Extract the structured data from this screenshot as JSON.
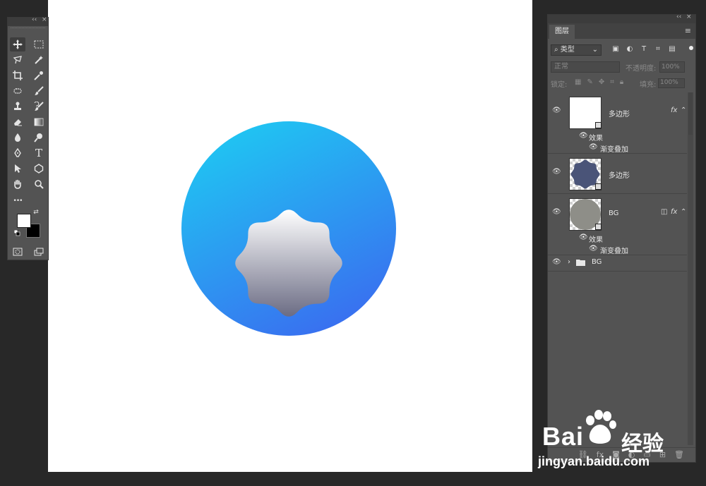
{
  "tools_panel": {
    "collapse_glyph": "‹‹",
    "close_glyph": "×",
    "tools": [
      {
        "icon": "move-tool-icon"
      },
      {
        "icon": "marquee-tool-icon"
      },
      {
        "icon": "lasso-tool-icon"
      },
      {
        "icon": "magic-wand-tool-icon"
      },
      {
        "icon": "crop-tool-icon"
      },
      {
        "icon": "eyedropper-tool-icon"
      },
      {
        "icon": "healing-brush-tool-icon"
      },
      {
        "icon": "brush-tool-icon"
      },
      {
        "icon": "clone-stamp-tool-icon"
      },
      {
        "icon": "history-brush-tool-icon"
      },
      {
        "icon": "eraser-tool-icon"
      },
      {
        "icon": "gradient-tool-icon"
      },
      {
        "icon": "blur-tool-icon"
      },
      {
        "icon": "dodge-tool-icon"
      },
      {
        "icon": "pen-tool-icon"
      },
      {
        "icon": "type-tool-icon",
        "glyph": "T"
      },
      {
        "icon": "path-selection-tool-icon"
      },
      {
        "icon": "shape-tool-icon"
      },
      {
        "icon": "hand-tool-icon"
      },
      {
        "icon": "zoom-tool-icon"
      },
      {
        "icon": "more-tools-icon",
        "glyph": "•••"
      }
    ],
    "foreground_color": "#ffffff",
    "background_color": "#000000"
  },
  "layers_panel": {
    "collapse_glyph": "‹‹",
    "close_glyph": "×",
    "tab_label": "图层",
    "filter_kind": "类型",
    "blend_mode": "正常",
    "opacity_label": "不透明度:",
    "opacity_value": "100%",
    "lock_label": "锁定:",
    "fill_label": "填充:",
    "fill_value": "100%",
    "layers": [
      {
        "name": "多边形",
        "thumb_color": "#ffffff",
        "has_fx": true,
        "effects_label": "效果",
        "effect": "渐变叠加"
      },
      {
        "name": "多边形",
        "thumb_color": "#4a5478",
        "has_fx": false
      },
      {
        "name": "BG",
        "thumb_color": "#8e8e88",
        "has_fx": true,
        "effects_label": "效果",
        "effect": "渐变叠加"
      },
      {
        "name": "BG",
        "is_group": true
      }
    ],
    "fx_label": "fx"
  },
  "canvas": {
    "background": "#ffffff",
    "circle_gradient": [
      "#1fc7f2",
      "#3a6cf0"
    ],
    "badge_gradient": [
      "#ffffff",
      "#6b6c84"
    ]
  },
  "watermark": {
    "text_bai": "Bai",
    "text_jingyan": "经验",
    "url": "jingyan.baidu.com"
  }
}
